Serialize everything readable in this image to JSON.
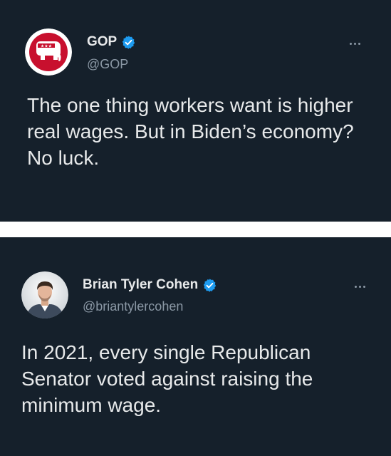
{
  "tweets": [
    {
      "display_name": "GOP",
      "handle": "@GOP",
      "verified": true,
      "avatar_icon": "republican-elephant-logo-icon",
      "text": "The one thing workers want is higher real wages. But in Biden’s economy? No luck."
    },
    {
      "display_name": "Brian Tyler Cohen",
      "handle": "@briantylercohen",
      "verified": true,
      "avatar_icon": "profile-photo",
      "text": "In 2021, every single Republican Senator voted against raising the minimum wage."
    }
  ],
  "colors": {
    "card_background": "#15202b",
    "divider": "#ffffff",
    "text_primary": "#e7e9ea",
    "text_secondary": "#8b98a5",
    "verified_blue": "#1d9bf0",
    "gop_red": "#c8102e"
  }
}
